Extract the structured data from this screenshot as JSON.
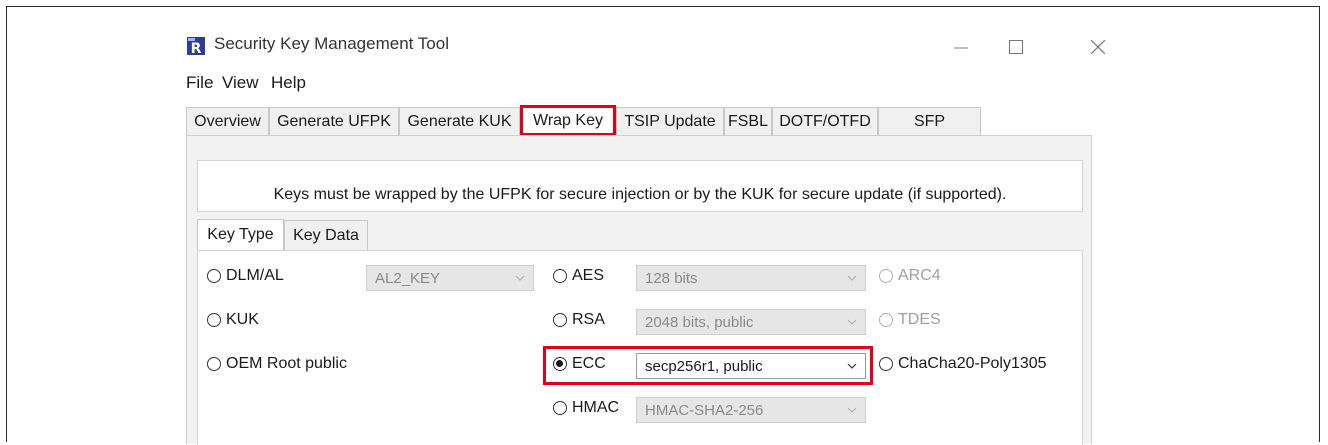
{
  "window": {
    "title": "Security Key Management Tool",
    "app_icon": "renesas-r-icon"
  },
  "menu": [
    "File",
    "View",
    "Help"
  ],
  "tabs": [
    {
      "label": "Overview"
    },
    {
      "label": "Generate UFPK"
    },
    {
      "label": "Generate KUK"
    },
    {
      "label": "Wrap Key",
      "active": true
    },
    {
      "label": "TSIP Update"
    },
    {
      "label": "FSBL"
    },
    {
      "label": "DOTF/OTFD"
    },
    {
      "label": "SFP"
    }
  ],
  "info_text": "Keys must be wrapped by the UFPK for secure injection or by the KUK for secure update (if supported).",
  "subtabs": [
    {
      "label": "Key Type",
      "active": true
    },
    {
      "label": "Key Data"
    }
  ],
  "key_types": {
    "dlm_al": {
      "label": "DLM/AL",
      "combo": "AL2_KEY"
    },
    "kuk": {
      "label": "KUK"
    },
    "oem_root": {
      "label": "OEM Root public"
    },
    "aes": {
      "label": "AES",
      "combo": "128 bits"
    },
    "rsa": {
      "label": "RSA",
      "combo": "2048 bits, public"
    },
    "ecc": {
      "label": "ECC",
      "combo": "secp256r1, public",
      "selected": true
    },
    "hmac": {
      "label": "HMAC",
      "combo": "HMAC-SHA2-256"
    },
    "arc4": {
      "label": "ARC4"
    },
    "tdes": {
      "label": "TDES"
    },
    "chacha": {
      "label": "ChaCha20-Poly1305"
    }
  },
  "colors": {
    "highlight": "#e0001b",
    "panel": "#f2f2f2"
  }
}
